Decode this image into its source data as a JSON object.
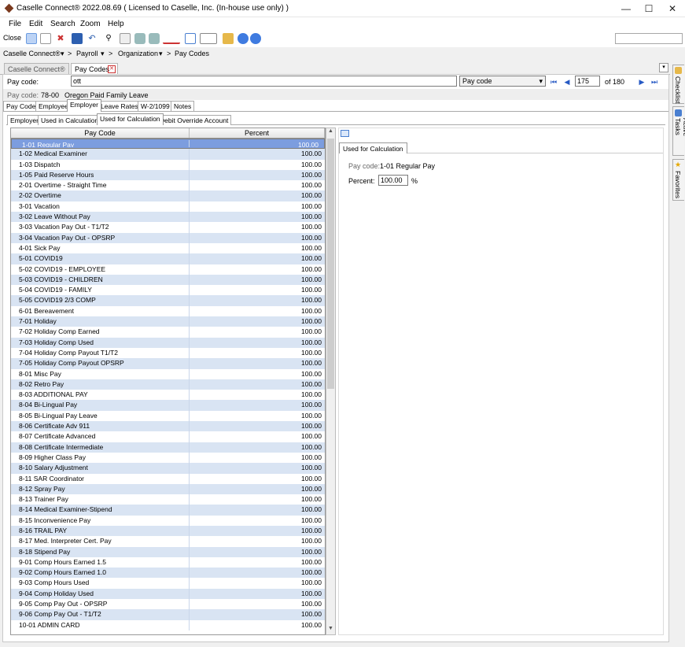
{
  "window": {
    "title": "Caselle Connect® 2022.08.69    ( Licensed to Caselle, Inc. (In-house use only) )",
    "minimize": "—",
    "maximize": "☐",
    "close": "✕"
  },
  "menu": [
    "File",
    "Edit",
    "Search",
    "Zoom",
    "Help"
  ],
  "toolbar": {
    "close_label": "Close"
  },
  "breadcrumb": {
    "items": [
      "Caselle Connect®",
      "Payroll",
      "Organization"
    ],
    "current": "Pay Codes",
    "sep": ">",
    "drop": "▾"
  },
  "doc_tabs": [
    {
      "label": "Caselle Connect®"
    },
    {
      "label": "Pay Codes",
      "close": "✕"
    }
  ],
  "lookup": {
    "label": "Pay code:",
    "value": "ott",
    "search_by": "Pay code",
    "record": "175",
    "of_total": "of 180",
    "nav_first": "⏮",
    "nav_prev": "◀",
    "nav_next": "▶",
    "nav_last": "⏭"
  },
  "info": {
    "label": "Pay code:",
    "code": "78-00",
    "desc": "Oregon Paid Family Leave"
  },
  "main_tabs": [
    "Pay Code",
    "Employee",
    "Employer",
    "Leave Rates",
    "W-2/1099",
    "Notes"
  ],
  "sub_tabs": [
    "Employer",
    "Used in Calculations",
    "Used for Calculation",
    "Debit Override Account"
  ],
  "grid": {
    "columns": [
      "Pay Code",
      "Percent"
    ],
    "rows": [
      [
        "1-01 Regular Pay",
        "100.00"
      ],
      [
        "1-02 Medical Examiner",
        "100.00"
      ],
      [
        "1-03 Dispatch",
        "100.00"
      ],
      [
        "1-05 Paid Reserve Hours",
        "100.00"
      ],
      [
        "2-01 Overtime - Straight Time",
        "100.00"
      ],
      [
        "2-02 Overtime",
        "100.00"
      ],
      [
        "3-01 Vacation",
        "100.00"
      ],
      [
        "3-02 Leave Without Pay",
        "100.00"
      ],
      [
        "3-03 Vacation Pay Out - T1/T2",
        "100.00"
      ],
      [
        "3-04 Vacation Pay Out - OPSRP",
        "100.00"
      ],
      [
        "4-01 Sick Pay",
        "100.00"
      ],
      [
        "5-01 COVID19",
        "100.00"
      ],
      [
        "5-02 COVID19 - EMPLOYEE",
        "100.00"
      ],
      [
        "5-03 COVID19 - CHILDREN",
        "100.00"
      ],
      [
        "5-04 COVID19 - FAMILY",
        "100.00"
      ],
      [
        "5-05 COVID19 2/3 COMP",
        "100.00"
      ],
      [
        "6-01 Bereavement",
        "100.00"
      ],
      [
        "7-01 Holiday",
        "100.00"
      ],
      [
        "7-02 Holiday Comp Earned",
        "100.00"
      ],
      [
        "7-03 Holiday Comp Used",
        "100.00"
      ],
      [
        "7-04 Holiday Comp Payout T1/T2",
        "100.00"
      ],
      [
        "7-05 Holiday Comp Payout OPSRP",
        "100.00"
      ],
      [
        "8-01 Misc Pay",
        "100.00"
      ],
      [
        "8-02 Retro Pay",
        "100.00"
      ],
      [
        "8-03 ADDITIONAL PAY",
        "100.00"
      ],
      [
        "8-04 Bi-Lingual Pay",
        "100.00"
      ],
      [
        "8-05 Bi-Lingual Pay Leave",
        "100.00"
      ],
      [
        "8-06 Certificate Adv 911",
        "100.00"
      ],
      [
        "8-07 Certificate Advanced",
        "100.00"
      ],
      [
        "8-08 Certificate Intermediate",
        "100.00"
      ],
      [
        "8-09 Higher Class Pay",
        "100.00"
      ],
      [
        "8-10 Salary Adjustment",
        "100.00"
      ],
      [
        "8-11 SAR Coordinator",
        "100.00"
      ],
      [
        "8-12 Spray Pay",
        "100.00"
      ],
      [
        "8-13 Trainer Pay",
        "100.00"
      ],
      [
        "8-14 Medical Examiner-Stipend",
        "100.00"
      ],
      [
        "8-15 Inconvenience Pay",
        "100.00"
      ],
      [
        "8-16 TRAIL PAY",
        "100.00"
      ],
      [
        "8-17 Med. Interpreter Cert. Pay",
        "100.00"
      ],
      [
        "8-18 Stipend Pay",
        "100.00"
      ],
      [
        "9-01 Comp Hours Earned 1.5",
        "100.00"
      ],
      [
        "9-02 Comp Hours Earned 1.0",
        "100.00"
      ],
      [
        "9-03 Comp Hours Used",
        "100.00"
      ],
      [
        "9-04 Comp Holiday Used",
        "100.00"
      ],
      [
        "9-05 Comp Pay Out - OPSRP",
        "100.00"
      ],
      [
        "9-06 Comp Pay Out - T1/T2",
        "100.00"
      ],
      [
        "10-01 ADMIN CARD",
        "100.00"
      ]
    ]
  },
  "detail": {
    "tab": "Used for Calculation",
    "paycode_label": "Pay code:",
    "paycode_value": "1-01 Regular Pay",
    "percent_label": "Percent:",
    "percent_value": "100.00",
    "percent_unit": "%"
  },
  "side_tabs": [
    "Checklist",
    "Active Tasks",
    "Favorites"
  ]
}
